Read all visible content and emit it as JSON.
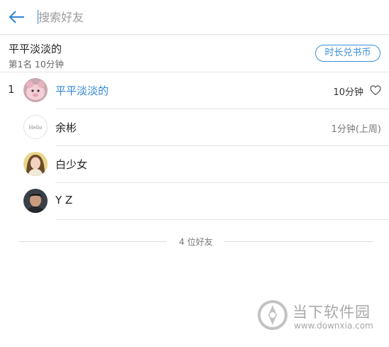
{
  "search": {
    "placeholder": "搜索好友",
    "value": ""
  },
  "my_rank": {
    "name": "平平淡淡的",
    "summary": "第1名 10分钟",
    "redeem_label": "时长兑书币"
  },
  "friends": [
    {
      "rank": "1",
      "name": "平平淡淡的",
      "time": "10分钟",
      "highlight": true,
      "avatar_icon": "pink-toy-avatar"
    },
    {
      "rank": "",
      "name": "余彬",
      "time": "1分钟(上周)",
      "highlight": false,
      "avatar_icon": "hello-text-avatar",
      "avatar_text": "Hello"
    },
    {
      "rank": "",
      "name": "白少女",
      "time": "",
      "highlight": false,
      "avatar_icon": "woman-photo-avatar"
    },
    {
      "rank": "",
      "name": "Y  Z",
      "time": "",
      "highlight": false,
      "avatar_icon": "man-photo-avatar"
    }
  ],
  "footer": {
    "count_label": "4 位好友"
  },
  "watermark": {
    "title": "当下软件园",
    "url": "www.downxia.com"
  },
  "colors": {
    "accent": "#2f86d6",
    "divider": "#e4e4e4",
    "muted_text": "#777777"
  },
  "icons": {
    "back": "back-arrow-icon",
    "like": "heart-outline-icon"
  }
}
